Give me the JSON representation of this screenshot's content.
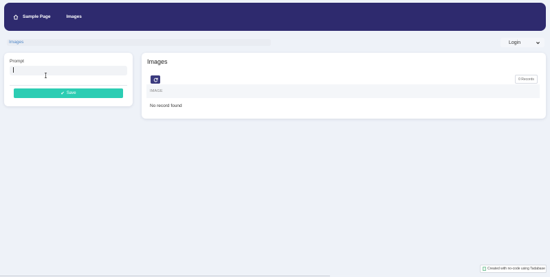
{
  "nav": {
    "home_label": "Sample Page",
    "images_label": "Images",
    "bg_color": "#2e2a6e"
  },
  "breadcrumb": {
    "label": "Images"
  },
  "login": {
    "label": "Login"
  },
  "form": {
    "prompt_label": "Prompt",
    "prompt_value": "",
    "save_label": "Save",
    "save_color": "#2ccdb3"
  },
  "images": {
    "title": "Images",
    "records_label": "0 Records",
    "column_header": "IMAGE",
    "empty_message": "No record found"
  },
  "footer": {
    "label": "Created with no-code using Tadabase"
  },
  "icons": {
    "home": "home-icon",
    "chevron": "chevron-down-icon",
    "check": "check-icon",
    "refresh": "refresh-icon",
    "text_cursor": "text-cursor-icon",
    "logo": "tadabase-logo-icon"
  }
}
